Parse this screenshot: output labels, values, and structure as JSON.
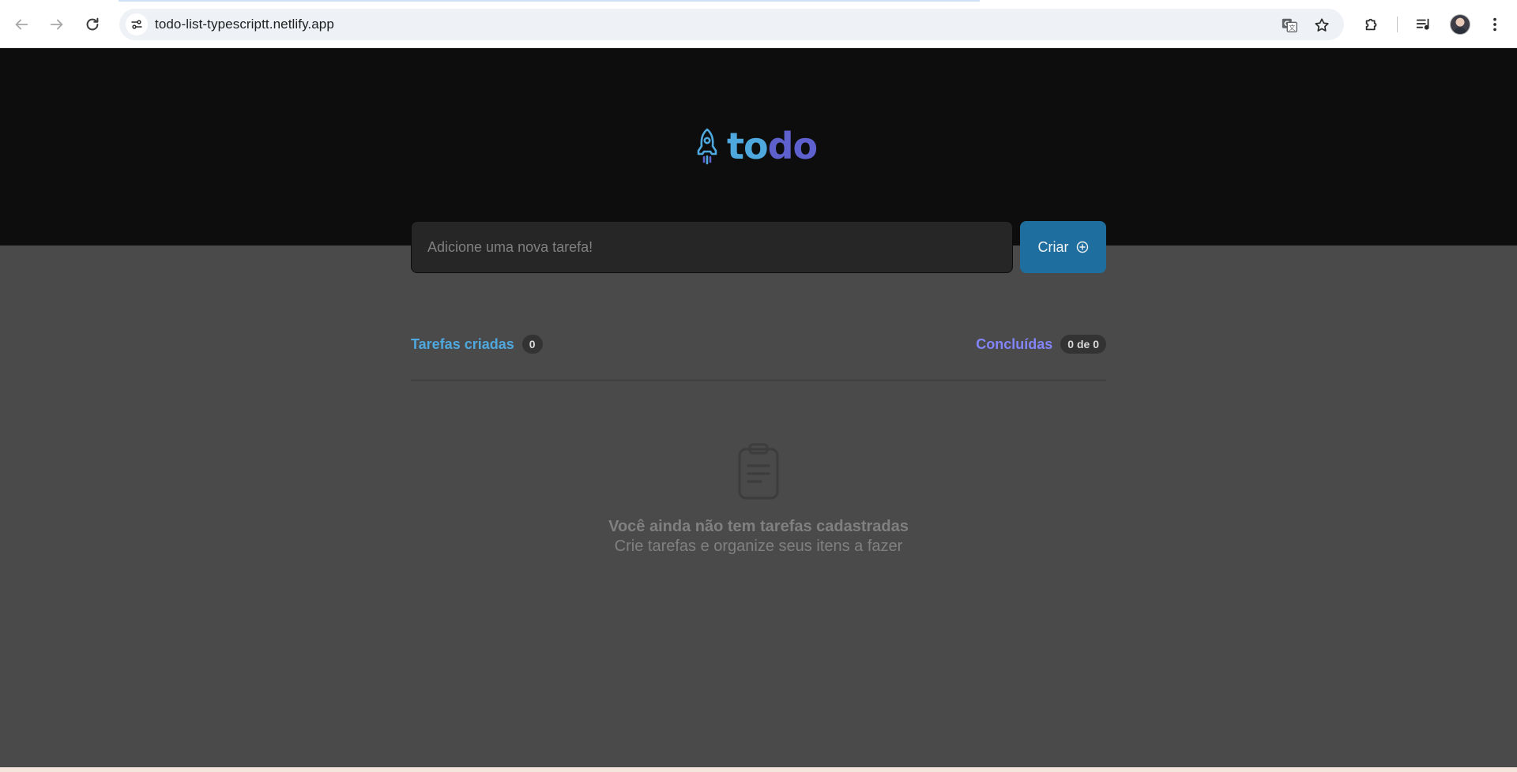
{
  "browser": {
    "url": "todo-list-typescriptt.netlify.app",
    "icons": {
      "back": "arrow-left-icon",
      "forward": "arrow-right-icon",
      "reload": "reload-icon",
      "site_info": "tune-icon",
      "translate": "translate-icon",
      "bookmark": "star-icon",
      "extensions": "puzzle-icon",
      "media": "media-control-icon",
      "menu": "kebab-menu-icon"
    }
  },
  "app": {
    "logo": {
      "part1": "to",
      "part2": "do",
      "icon": "rocket-icon"
    },
    "input": {
      "placeholder": "Adicione uma nova tarefa!",
      "value": ""
    },
    "create_button": {
      "label": "Criar",
      "icon": "plus-circle-icon"
    },
    "counters": {
      "created_label": "Tarefas criadas",
      "created_count": "0",
      "done_label": "Concluídas",
      "done_count": "0 de 0"
    },
    "empty_state": {
      "icon": "clipboard-icon",
      "title": "Você ainda não tem tarefas cadastradas",
      "subtitle": "Crie tarefas e organize seus itens a fazer"
    },
    "colors": {
      "header_bg": "#0d0d0d",
      "body_bg": "#4a4a4a",
      "blue": "#4ea8de",
      "purple": "#5e60ce",
      "purple_light": "#8284fa",
      "button": "#1e6f9f"
    }
  }
}
